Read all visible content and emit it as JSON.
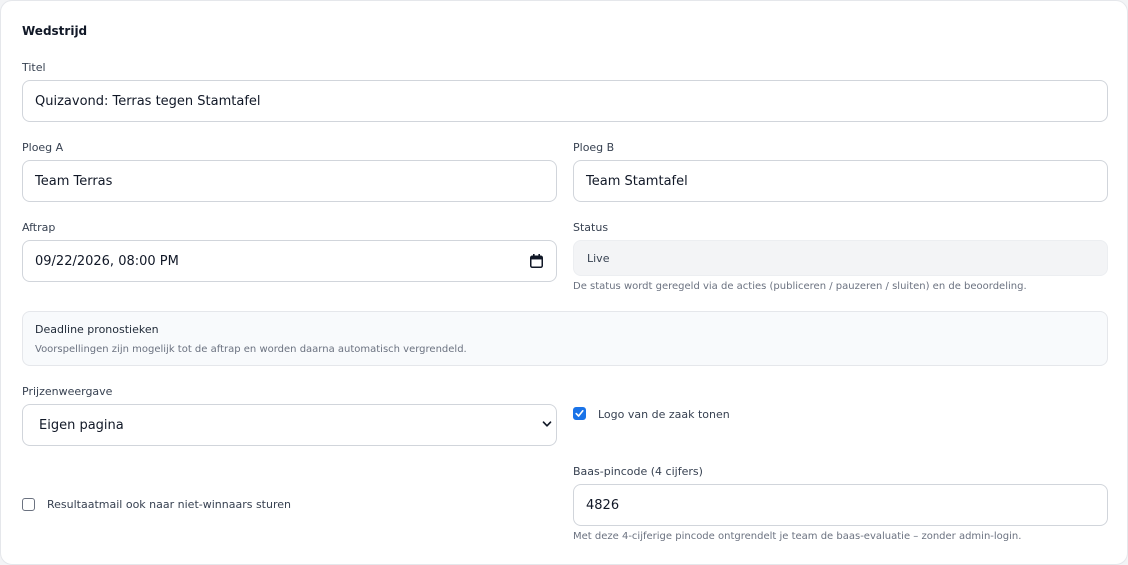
{
  "form": {
    "section_title": "Wedstrijd",
    "title_label": "Titel",
    "title_value": "Quizavond: Terras tegen Stamtafel",
    "team_a_label": "Ploeg A",
    "team_a_value": "Team Terras",
    "team_b_label": "Ploeg B",
    "team_b_value": "Team Stamtafel",
    "kickoff_label": "Aftrap",
    "kickoff_value": "09/22/2026, 08:00 PM",
    "status_label": "Status",
    "status_value": "Live",
    "status_help": "De status wordt geregeld via de acties (publiceren / pauzeren / sluiten) en de beoordeling.",
    "deadline_title": "Deadline pronostieken",
    "deadline_text": "Voorspellingen zijn mogelijk tot de aftrap en worden daarna automatisch vergrendeld.",
    "prize_label": "Prijzenweergave",
    "prize_value": "Eigen pagina",
    "logo_checkbox_label": "Logo van de zaak tonen",
    "logo_checked": true,
    "result_mail_label": "Resultaatmail ook naar niet-winnaars sturen",
    "result_mail_checked": false,
    "pin_label": "Baas-pincode (4 cijfers)",
    "pin_value": "4826",
    "pin_help": "Met deze 4-cijferige pincode ontgrendelt je team de baas-evaluatie – zonder admin-login."
  },
  "colors": {
    "accent": "#1a73e8",
    "border": "#d1d5db",
    "muted": "#6b7280"
  },
  "icons": {
    "kickoff": "calendar-icon",
    "prize_select": "chevron-down-icon",
    "checkbox": "checkmark-icon"
  }
}
